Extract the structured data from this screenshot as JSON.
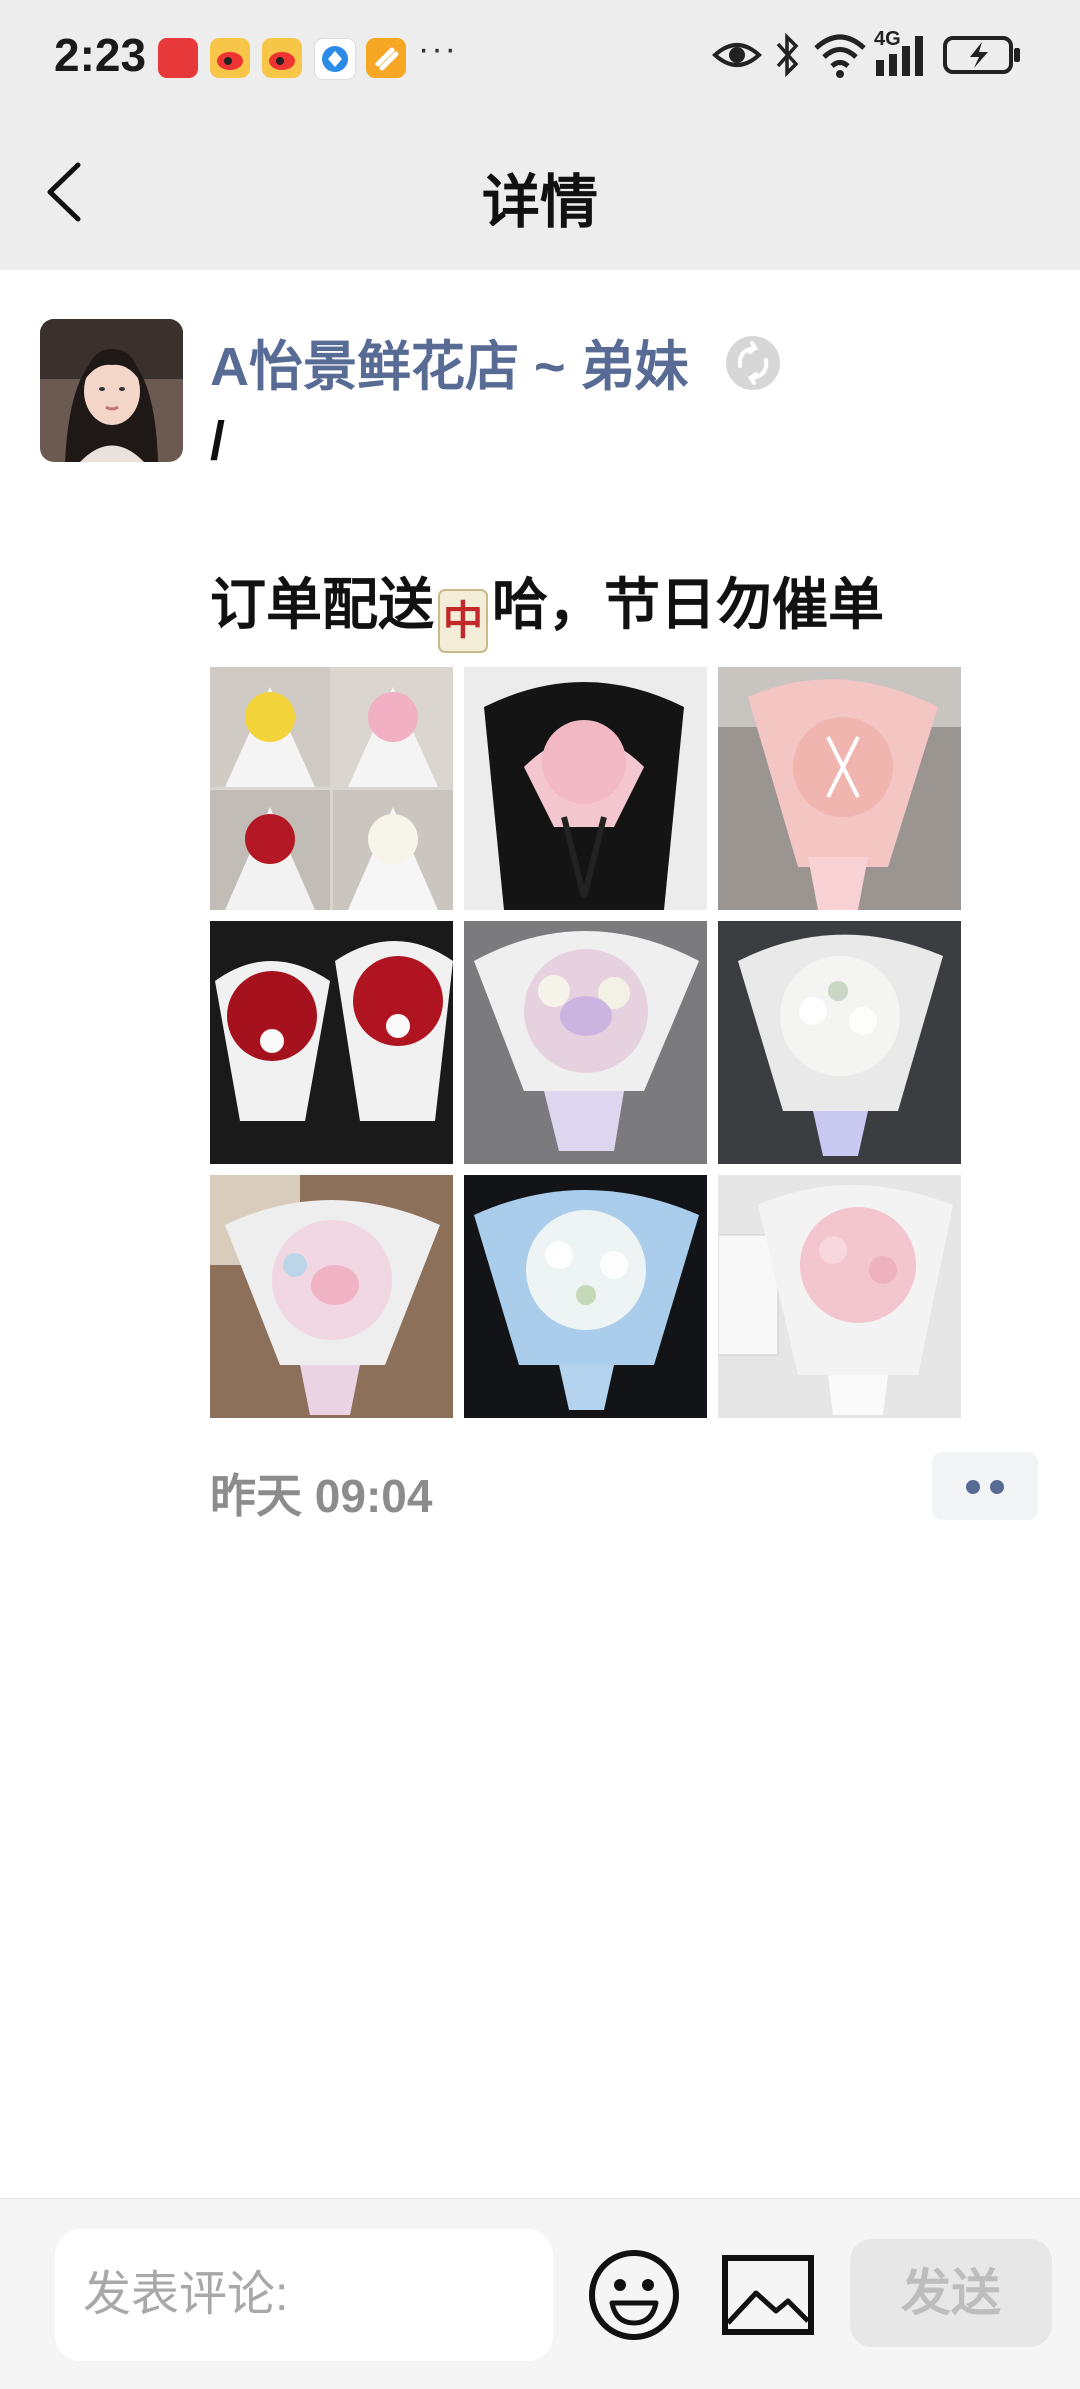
{
  "status_bar": {
    "time": "2:23",
    "more": "···",
    "network": "4G",
    "app_icons": [
      "huawei-app-icon",
      "weibo-icon",
      "weibo-icon",
      "browser-icon",
      "app-icon"
    ]
  },
  "nav": {
    "title": "详情"
  },
  "post": {
    "author": "A怡景鲜花店 ~ 弟妹",
    "slash": "/",
    "text_before": "订单配送",
    "mahjong_char": "中",
    "text_after": "哈，节日勿催单",
    "time": "昨天 09:04",
    "photos": [
      {
        "name": "photo-bouquet-collage"
      },
      {
        "name": "photo-pink-roses-black-wrap"
      },
      {
        "name": "photo-pink-roses-polka-wrap"
      },
      {
        "name": "photo-red-roses-pair"
      },
      {
        "name": "photo-lilac-orchid-bouquet"
      },
      {
        "name": "photo-white-stock-bouquet"
      },
      {
        "name": "photo-pastel-orchid-bouquet"
      },
      {
        "name": "photo-blue-white-bouquet"
      },
      {
        "name": "photo-pink-roses-white-wrap"
      }
    ]
  },
  "composer": {
    "placeholder": "发表评论:",
    "send_label": "发送"
  },
  "colors": {
    "link_blue": "#576b95",
    "bar_gray": "#ededed"
  }
}
